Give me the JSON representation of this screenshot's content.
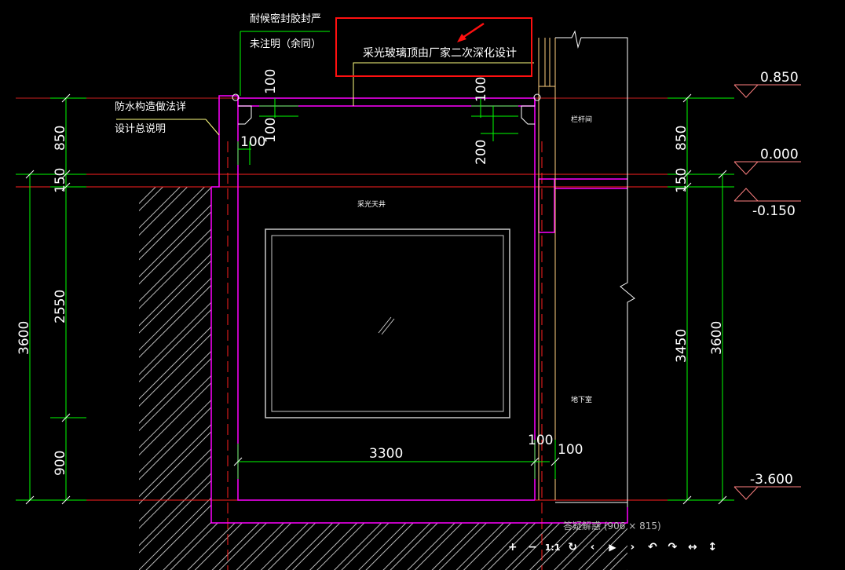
{
  "drawing": {
    "highlight_note": "采光玻璃顶由厂家二次深化设计",
    "sealant_note_line1": "耐候密封胶封严",
    "sealant_note_line2": "未注明（余同）",
    "waterproof_note_line1": "防水构造做法详",
    "waterproof_note_line2": "设计总说明",
    "label_lighting_well": "采光天井",
    "label_guardrail": "栏杆间",
    "label_basement": "地下室",
    "dims": {
      "left_850": "850",
      "left_150": "150",
      "left_2550": "2550",
      "left_3600": "3600",
      "left_900": "900",
      "right_850": "850",
      "right_150": "150",
      "right_3450": "3450",
      "right_3600": "3600",
      "top_100a": "100",
      "top_100b": "100",
      "top_100c": "100",
      "top_100d": "100",
      "mid_200": "200",
      "bottom_3300": "3300",
      "bottom_100a": "100",
      "bottom_100b": "100"
    },
    "elevations": {
      "e1": "0.850",
      "e2": "0.000",
      "e3": "-0.150",
      "e4": "-3.600"
    },
    "colors": {
      "dimension": "#00ff00",
      "wall": "#ff00ff",
      "axis": "#ff0000",
      "text": "#ffffff",
      "frame": "#ffff80",
      "highlight_box": "#ff0000"
    }
  },
  "viewer": {
    "caption": "答疑解惑 (906 × 815)",
    "buttons": {
      "zoom_in": "+",
      "zoom_out": "−",
      "actual_size": "1:1",
      "reset": "↻",
      "prev": "‹",
      "play": "▶",
      "next": "›",
      "rotate_left": "↶",
      "rotate_right": "↷",
      "flip_h": "↔",
      "flip_v": "↕"
    }
  }
}
